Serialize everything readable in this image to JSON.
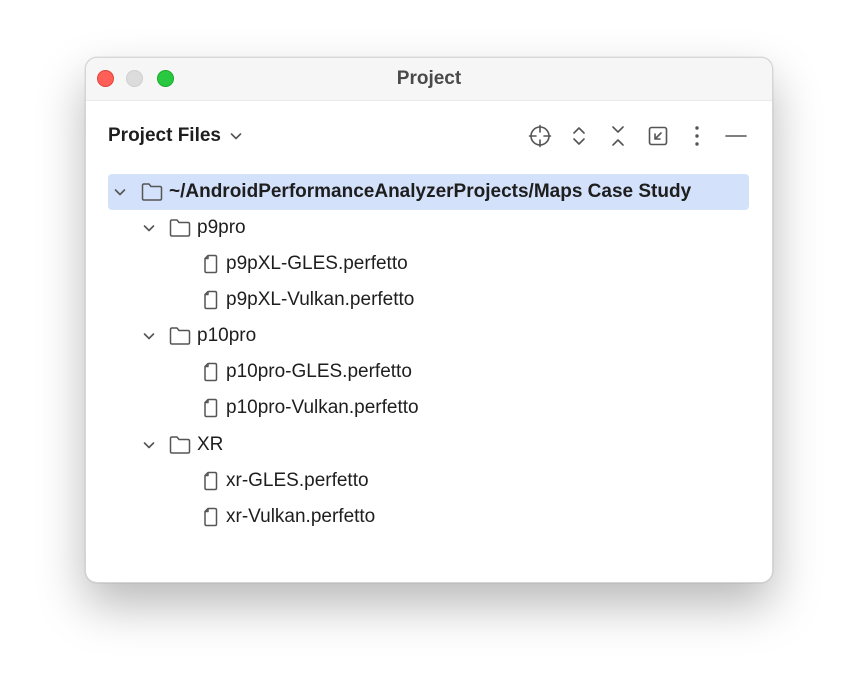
{
  "window": {
    "title": "Project"
  },
  "panel": {
    "title": "Project Files",
    "toolbar_icons": [
      "locate-icon",
      "expand-all-icon",
      "collapse-all-icon",
      "scroll-from-source-icon",
      "more-options-icon",
      "hide-panel-icon"
    ]
  },
  "tree": {
    "root": "~/AndroidPerformanceAnalyzerProjects/Maps Case Study",
    "folders": [
      {
        "name": "p9pro",
        "files": [
          "p9pXL-GLES.perfetto",
          "p9pXL-Vulkan.perfetto"
        ]
      },
      {
        "name": "p10pro",
        "files": [
          "p10pro-GLES.perfetto",
          "p10pro-Vulkan.perfetto"
        ]
      },
      {
        "name": "XR",
        "files": [
          "xr-GLES.perfetto",
          "xr-Vulkan.perfetto"
        ]
      }
    ]
  },
  "colors": {
    "selection": "#d4e1fb",
    "close": "#ff5f57",
    "minimize": "#dcdcdc",
    "maximize": "#28c840"
  }
}
